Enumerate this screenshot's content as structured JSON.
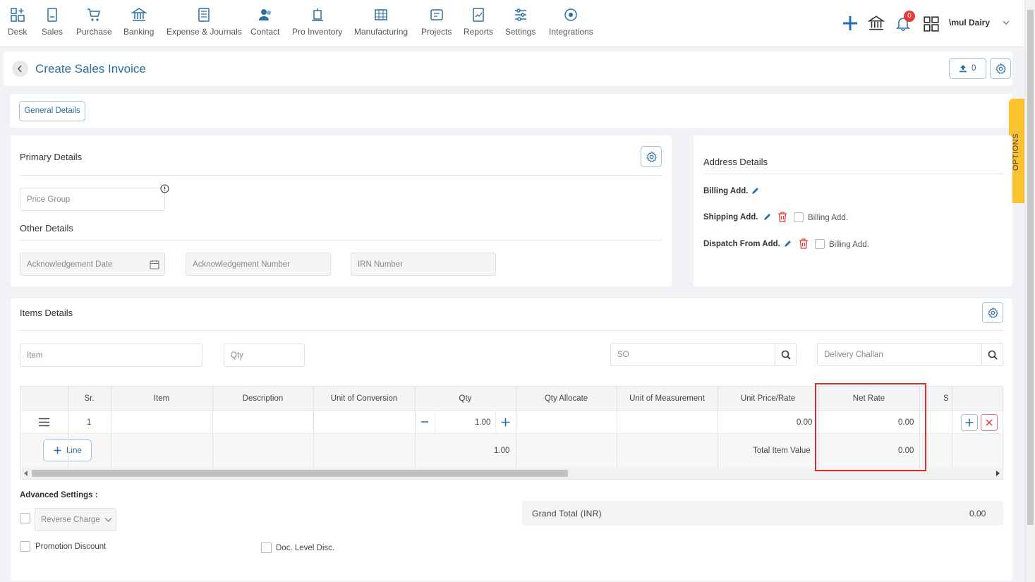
{
  "nav": {
    "items": [
      {
        "label": "Desk",
        "icon": "desk-icon"
      },
      {
        "label": "Sales",
        "icon": "sales-icon"
      },
      {
        "label": "Purchase",
        "icon": "cart-icon"
      },
      {
        "label": "Banking",
        "icon": "bank-icon"
      },
      {
        "label": "Expense & Journals",
        "icon": "journal-icon"
      },
      {
        "label": "Contact",
        "icon": "contact-icon"
      },
      {
        "label": "Pro Inventory",
        "icon": "inventory-icon"
      },
      {
        "label": "Manufacturing",
        "icon": "manufacturing-icon"
      },
      {
        "label": "Projects",
        "icon": "projects-icon"
      },
      {
        "label": "Reports",
        "icon": "reports-icon"
      },
      {
        "label": "Settings",
        "icon": "settings-sliders-icon"
      },
      {
        "label": "Integrations",
        "icon": "integrations-icon"
      }
    ],
    "notification_count": "0",
    "company": "\\mul Dairy"
  },
  "page": {
    "title": "Create Sales Invoice",
    "upload_count": "0",
    "general_tab": "General Details",
    "options_label": "OPTIONS"
  },
  "primary": {
    "title": "Primary Details",
    "price_group_placeholder": "Price Group",
    "other_title": "Other Details",
    "ack_date_placeholder": "Acknowledgement Date",
    "ack_number_placeholder": "Acknowledgement Number",
    "irn_placeholder": "IRN Number"
  },
  "address": {
    "title": "Address Details",
    "billing": "Billing Add.",
    "shipping": "Shipping Add.",
    "shipping_same": "Billing Add.",
    "dispatch": "Dispatch From Add.",
    "dispatch_same": "Billing Add."
  },
  "items": {
    "title": "Items Details",
    "item_placeholder": "Item",
    "qty_placeholder": "Qty",
    "so_placeholder": "SO",
    "dc_placeholder": "Delivery Challan",
    "columns": [
      "Sr.",
      "Item",
      "Description",
      "Unit of Conversion",
      "Qty",
      "Qty Allocate",
      "Unit of Measurement",
      "Unit Price/Rate",
      "Net Rate",
      "S"
    ],
    "row": {
      "sr": "1",
      "qty": "1.00",
      "unit_price": "0.00",
      "net_rate": "0.00"
    },
    "add_line": "Line",
    "total_qty": "1.00",
    "total_label": "Total Item Value",
    "total_value": "0.00"
  },
  "advanced": {
    "title": "Advanced Settings :",
    "reverse_charge": "Reverse Charge",
    "promotion_discount": "Promotion Discount",
    "doc_level_disc": "Doc. Level Disc."
  },
  "grand_total": {
    "label": "Grand Total (INR)",
    "value": "0.00"
  },
  "colors": {
    "accent": "#2a6fa3",
    "highlight": "#d32f2f",
    "options_tab": "#f9c22e",
    "danger": "#e53935"
  }
}
